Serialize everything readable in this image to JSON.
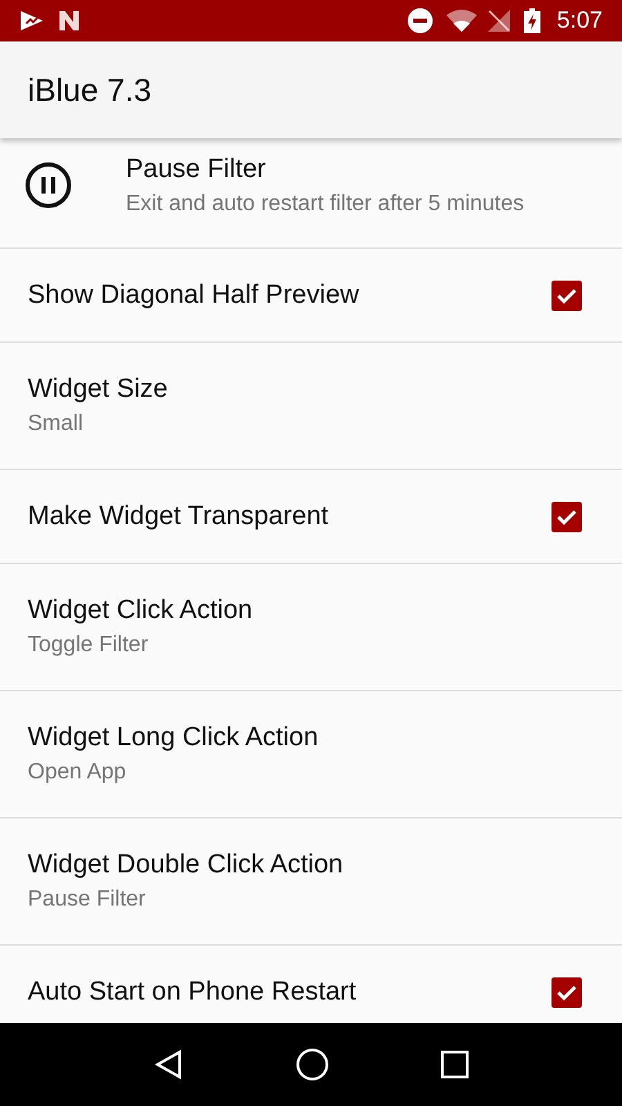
{
  "status_bar": {
    "time": "5:07"
  },
  "app_bar": {
    "title": "iBlue 7.3"
  },
  "settings": [
    {
      "kind": "action",
      "title": "Pause Filter",
      "summary": "Exit and auto restart filter after 5 minutes"
    },
    {
      "kind": "checkbox",
      "title": "Show Diagonal Half Preview",
      "checked": true
    },
    {
      "kind": "value",
      "title": "Widget Size",
      "summary": "Small"
    },
    {
      "kind": "checkbox",
      "title": "Make Widget Transparent",
      "checked": true
    },
    {
      "kind": "value",
      "title": "Widget Click Action",
      "summary": "Toggle Filter"
    },
    {
      "kind": "value",
      "title": "Widget Long Click Action",
      "summary": "Open App"
    },
    {
      "kind": "value",
      "title": "Widget Double Click Action",
      "summary": "Pause Filter"
    },
    {
      "kind": "checkbox",
      "title": "Auto Start on Phone Restart",
      "checked": true
    }
  ]
}
